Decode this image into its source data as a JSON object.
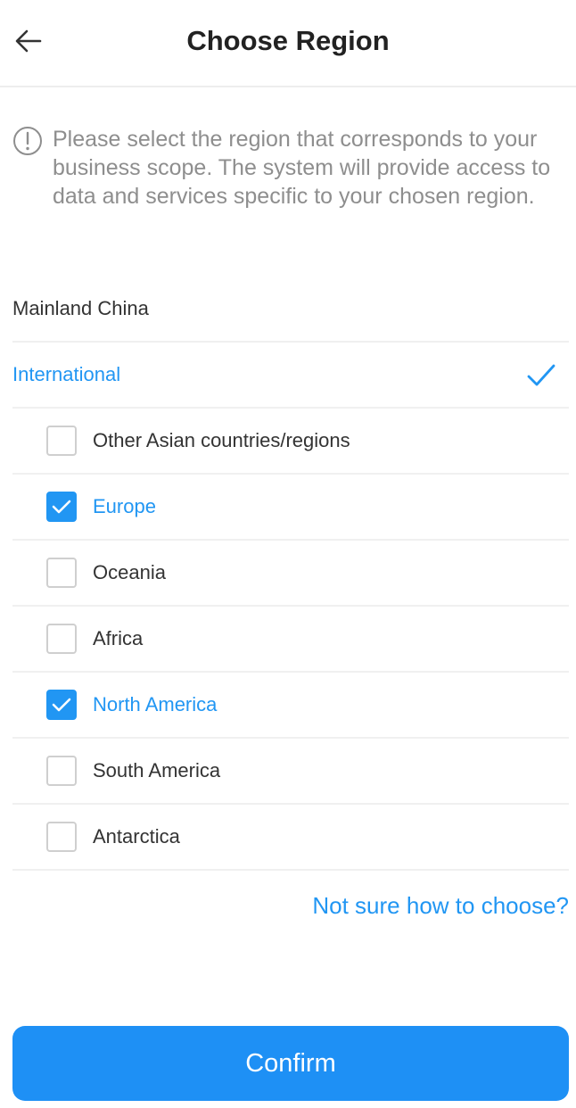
{
  "header": {
    "title": "Choose Region",
    "back_icon": "arrow-left-icon"
  },
  "notice": {
    "icon": "info-circle-icon",
    "text": "Please select the region that corresponds to your business scope. The system will provide access to data and services specific to your chosen region."
  },
  "regions": [
    {
      "label": "Mainland China",
      "selected": false
    },
    {
      "label": "International",
      "selected": true
    }
  ],
  "international_options": [
    {
      "label": "Other Asian countries/regions",
      "checked": false
    },
    {
      "label": "Europe",
      "checked": true
    },
    {
      "label": "Oceania",
      "checked": false
    },
    {
      "label": "Africa",
      "checked": false
    },
    {
      "label": "North America",
      "checked": true
    },
    {
      "label": "South America",
      "checked": false
    },
    {
      "label": "Antarctica",
      "checked": false
    }
  ],
  "help_link": "Not sure how to choose?",
  "confirm_label": "Confirm",
  "colors": {
    "accent": "#2196f3",
    "button": "#1e90f5",
    "muted_text": "#8e8e8e",
    "divider": "#f0f0f0"
  }
}
